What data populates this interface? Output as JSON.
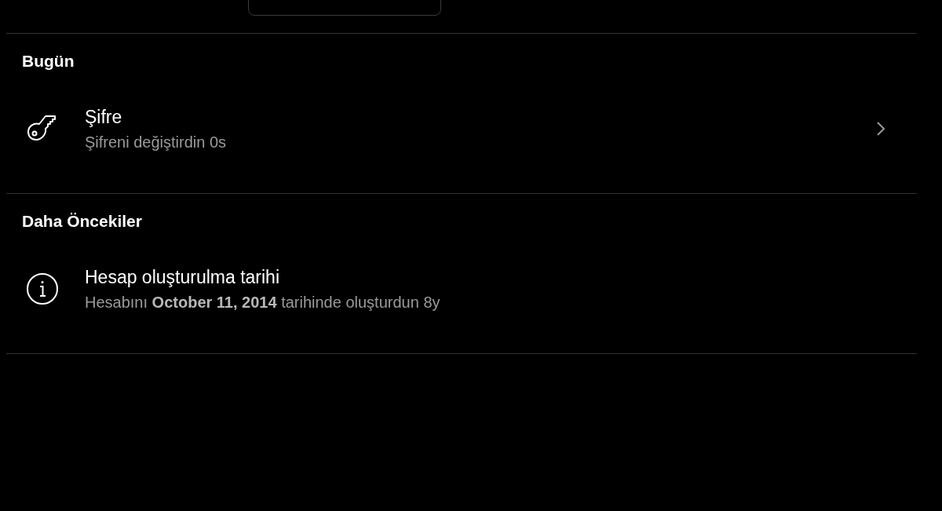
{
  "sections": [
    {
      "title": "Bugün",
      "items": [
        {
          "kind": "key",
          "title": "Şifre",
          "subtitle": "Şifreni değiştirdin 0s",
          "chevron": true
        }
      ]
    },
    {
      "title": "Daha Öncekiler",
      "items": [
        {
          "kind": "info",
          "title": "Hesap oluşturulma tarihi",
          "subtitle": "Hesabını **October 11, 2014** tarihinde oluşturdun 8y",
          "chevron": false
        }
      ]
    }
  ]
}
